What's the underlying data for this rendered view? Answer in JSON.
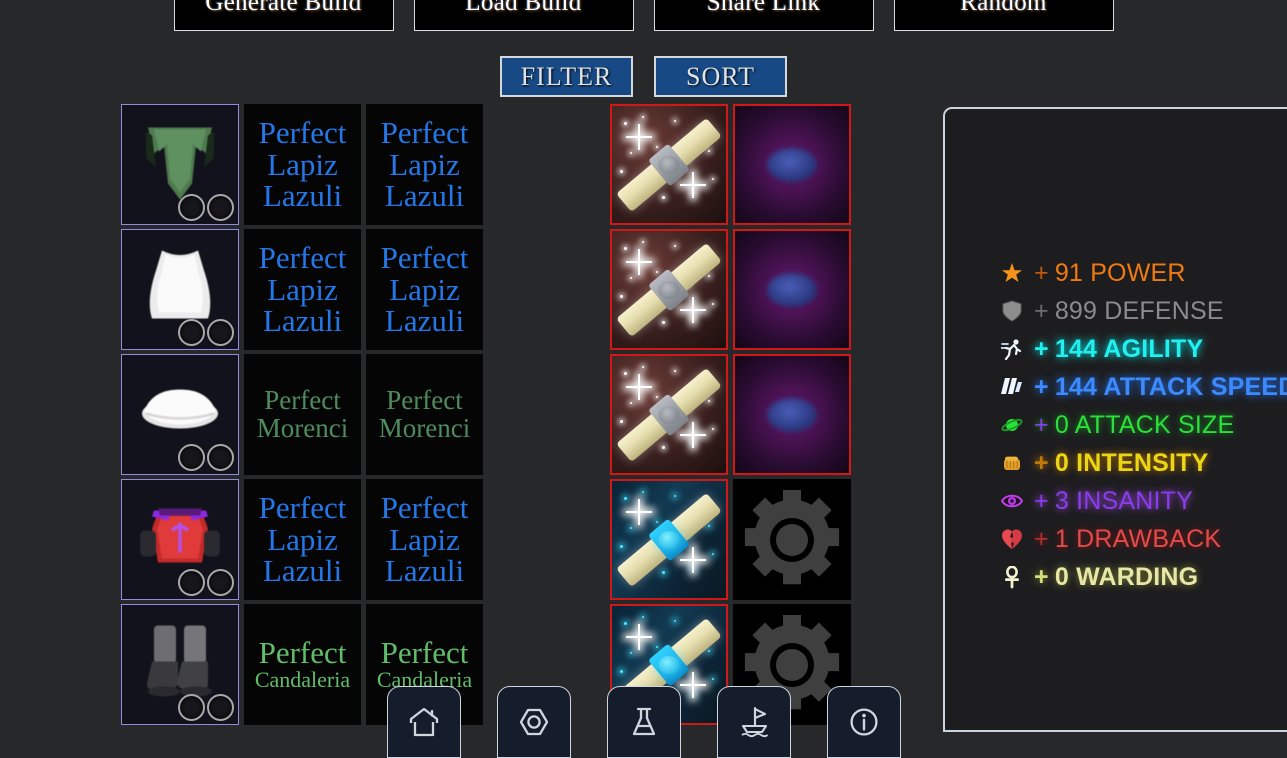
{
  "theme": {
    "background": "#272829",
    "panel_background": "#1d1d1f",
    "panel_border": "#c9d4de",
    "slot_border": "#8f8ce0",
    "scroll_border": "#d01818",
    "filter_button_bg": "#174a85",
    "nav_button_bg": "#151c2c"
  },
  "toolbar": {
    "buttons": [
      {
        "label": "Generate Build",
        "name": "generate-build-button"
      },
      {
        "label": "Load Build",
        "name": "load-build-button"
      },
      {
        "label": "Share Link",
        "name": "share-link-button"
      },
      {
        "label": "Random",
        "name": "random-button"
      }
    ]
  },
  "controls": {
    "filter_label": "FILTER",
    "sort_label": "SORT"
  },
  "gear_rows": [
    {
      "item": {
        "name": "green-skirt-item",
        "sockets": 2
      },
      "gem1": {
        "line1": "Perfect",
        "line2": "Lapiz",
        "line3": "Lazuli",
        "rarity": "lapiz"
      },
      "gem2": {
        "line1": "Perfect",
        "line2": "Lapiz",
        "line3": "Lazuli",
        "rarity": "lapiz"
      },
      "spacer": true,
      "scroll": {
        "name": "enchant-scroll-warm",
        "variant": "warm"
      },
      "modifier": {
        "name": "modifier-orb",
        "variant": "orb"
      }
    },
    {
      "item": {
        "name": "white-dress-item",
        "sockets": 2
      },
      "gem1": {
        "line1": "Perfect",
        "line2": "Lapiz",
        "line3": "Lazuli",
        "rarity": "lapiz"
      },
      "gem2": {
        "line1": "Perfect",
        "line2": "Lapiz",
        "line3": "Lazuli",
        "rarity": "lapiz"
      },
      "spacer": true,
      "scroll": {
        "name": "enchant-scroll-warm",
        "variant": "warm"
      },
      "modifier": {
        "name": "modifier-orb",
        "variant": "orb"
      }
    },
    {
      "item": {
        "name": "white-hat-item",
        "sockets": 2
      },
      "gem1": {
        "line1": "Perfect",
        "line2": "Morenci",
        "rarity": "morenci"
      },
      "gem2": {
        "line1": "Perfect",
        "line2": "Morenci",
        "rarity": "morenci"
      },
      "spacer": true,
      "scroll": {
        "name": "enchant-scroll-warm",
        "variant": "warm"
      },
      "modifier": {
        "name": "modifier-orb",
        "variant": "orb"
      }
    },
    {
      "item": {
        "name": "red-chestplate-item",
        "sockets": 2
      },
      "gem1": {
        "line1": "Perfect",
        "line2": "Lapiz",
        "line3": "Lazuli",
        "rarity": "lapiz"
      },
      "gem2": {
        "line1": "Perfect",
        "line2": "Lapiz",
        "line3": "Lazuli",
        "rarity": "lapiz"
      },
      "spacer": true,
      "scroll": {
        "name": "enchant-scroll-cool",
        "variant": "cool"
      },
      "modifier": {
        "name": "empty-gear-slot",
        "variant": "gear"
      }
    },
    {
      "item": {
        "name": "grey-boots-item",
        "sockets": 2
      },
      "gem1": {
        "line1": "Perfect",
        "line2": "Candaleria",
        "rarity": "candaleria"
      },
      "gem2": {
        "line1": "Perfect",
        "line2": "Candaleria",
        "rarity": "candaleria"
      },
      "spacer": true,
      "scroll": {
        "name": "enchant-scroll-cool",
        "variant": "cool"
      },
      "modifier": {
        "name": "empty-gear-slot",
        "variant": "gear"
      }
    }
  ],
  "stats": [
    {
      "icon": "star-icon",
      "op": "+",
      "value": "91",
      "label": "POWER",
      "style": "s-power",
      "color": "#f07a10"
    },
    {
      "icon": "shield-icon",
      "op": "+",
      "value": "899",
      "label": "DEFENSE",
      "style": "s-defense",
      "color": "#8b8b8b"
    },
    {
      "icon": "runner-icon",
      "op": "+",
      "value": "144",
      "label": "AGILITY",
      "style": "s-agility",
      "color": "#20f0f0"
    },
    {
      "icon": "speed-lines-icon",
      "op": "+",
      "value": "144",
      "label": "ATTACK SPEED",
      "style": "s-aspeed",
      "color": "#3b8bff"
    },
    {
      "icon": "planet-icon",
      "op": "+",
      "value": "0",
      "label": "ATTACK SIZE",
      "style": "s-asize",
      "color": "#2be03a"
    },
    {
      "icon": "fist-icon",
      "op": "+",
      "value": "0",
      "label": "INTENSITY",
      "style": "s-intens",
      "color": "#ead714"
    },
    {
      "icon": "eye-icon",
      "op": "+",
      "value": "3",
      "label": "INSANITY",
      "style": "s-insane",
      "color": "#8b3cf0"
    },
    {
      "icon": "broken-heart-icon",
      "op": "+",
      "value": "1",
      "label": "DRAWBACK",
      "style": "s-draw",
      "color": "#e14b4b"
    },
    {
      "icon": "ankh-icon",
      "op": "+",
      "value": "0",
      "label": "WARDING",
      "style": "s-ward",
      "color": "#e7e7a8"
    }
  ],
  "bottom_nav": [
    {
      "icon": "home-icon",
      "name": "nav-home"
    },
    {
      "icon": "hexagon-icon",
      "name": "nav-gems"
    },
    {
      "icon": "flask-icon",
      "name": "nav-potions"
    },
    {
      "icon": "sailboat-icon",
      "name": "nav-voyage"
    },
    {
      "icon": "info-icon",
      "name": "nav-info"
    }
  ]
}
